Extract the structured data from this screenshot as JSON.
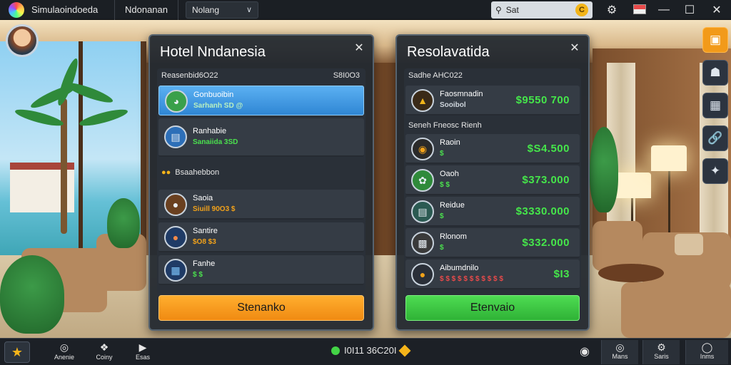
{
  "topbar": {
    "app_title": "Simulaoindoeda",
    "tab": "Ndonanan",
    "dropdown_value": "Nolang",
    "search_value": "Sat",
    "coin_symbol": "C"
  },
  "left_panel": {
    "title": "Hotel Nndanesia",
    "list_header_left": "Reasenbid6O22",
    "list_header_right": "S8I0O3",
    "section_label": "Bsaahebbon",
    "rows": [
      {
        "title": "Gonbuoibin",
        "sub": "Sarhanh SD @",
        "sub_color": "#b9f0c0",
        "icon": "bowl-icon",
        "icon_bg": "#3aa04a"
      },
      {
        "title": "Ranhabie",
        "sub": "Sanaiida 3SD",
        "sub_color": "#4be04e",
        "icon": "ticket-icon",
        "icon_bg": "#2d6fb8"
      },
      {
        "title": "Saoia",
        "sub": "Siuill 90O3 $",
        "sub_color": "#f2a21a",
        "icon": "food-icon",
        "icon_bg": "#6a4020"
      },
      {
        "title": "Santire",
        "sub": "$O8 $3",
        "sub_color": "#f2a21a",
        "icon": "ball-icon",
        "icon_bg": "#1f3b66"
      },
      {
        "title": "Fanhe",
        "sub": "$ $",
        "sub_color": "#4be04e",
        "icon": "card-icon",
        "icon_bg": "#1f3b66"
      }
    ],
    "button_label": "Stenanko"
  },
  "right_panel": {
    "title": "Resolavatida",
    "list_header_left": "Sadhe AHC022",
    "top_row": {
      "title": "Faosmnadin",
      "sub": "Sooibol",
      "value": "$9550 700",
      "icon": "bread-icon",
      "icon_bg": "#3a2a18"
    },
    "section_label": "Seneh Fneosc Rienh",
    "rows": [
      {
        "title": "Raoin",
        "sub": "$",
        "value": "$S4.500",
        "icon": "plate-icon",
        "icon_bg": "#2a2a2a"
      },
      {
        "title": "Oaoh",
        "sub": "$ $",
        "value": "$373.000",
        "icon": "leaf-icon",
        "icon_bg": "#2f8a3a"
      },
      {
        "title": "Reidue",
        "sub": "$",
        "value": "$3330.000",
        "icon": "doc-icon",
        "icon_bg": "#2b5a52"
      },
      {
        "title": "Rlonom",
        "sub": "$",
        "value": "$332.000",
        "icon": "box-icon",
        "icon_bg": "#3a3a3a"
      },
      {
        "title": "Aibumdnilo",
        "sub": "$ $ $ $ $ $ $ $ $ $ $",
        "value": "$I3",
        "icon": "cake-icon",
        "icon_bg": "#2a2f38"
      }
    ],
    "button_label": "Etenvaio"
  },
  "bottombar": {
    "items": [
      {
        "label": "Anenie",
        "icon": "circle-icon"
      },
      {
        "label": "Coiny",
        "icon": "puzzle-icon"
      },
      {
        "label": "Esas",
        "icon": "play-icon"
      }
    ],
    "coins": "I0I11 36C20I",
    "right_items": [
      {
        "label": "Mans",
        "icon": "map-icon"
      },
      {
        "label": "Saris",
        "icon": "gear-icon"
      },
      {
        "label": "Inms",
        "icon": "ring-icon"
      }
    ]
  },
  "colors": {
    "accent_orange": "#f29a1a",
    "accent_green": "#3fd444",
    "value_green": "#45e64a",
    "selected_blue": "#3a94e0"
  }
}
